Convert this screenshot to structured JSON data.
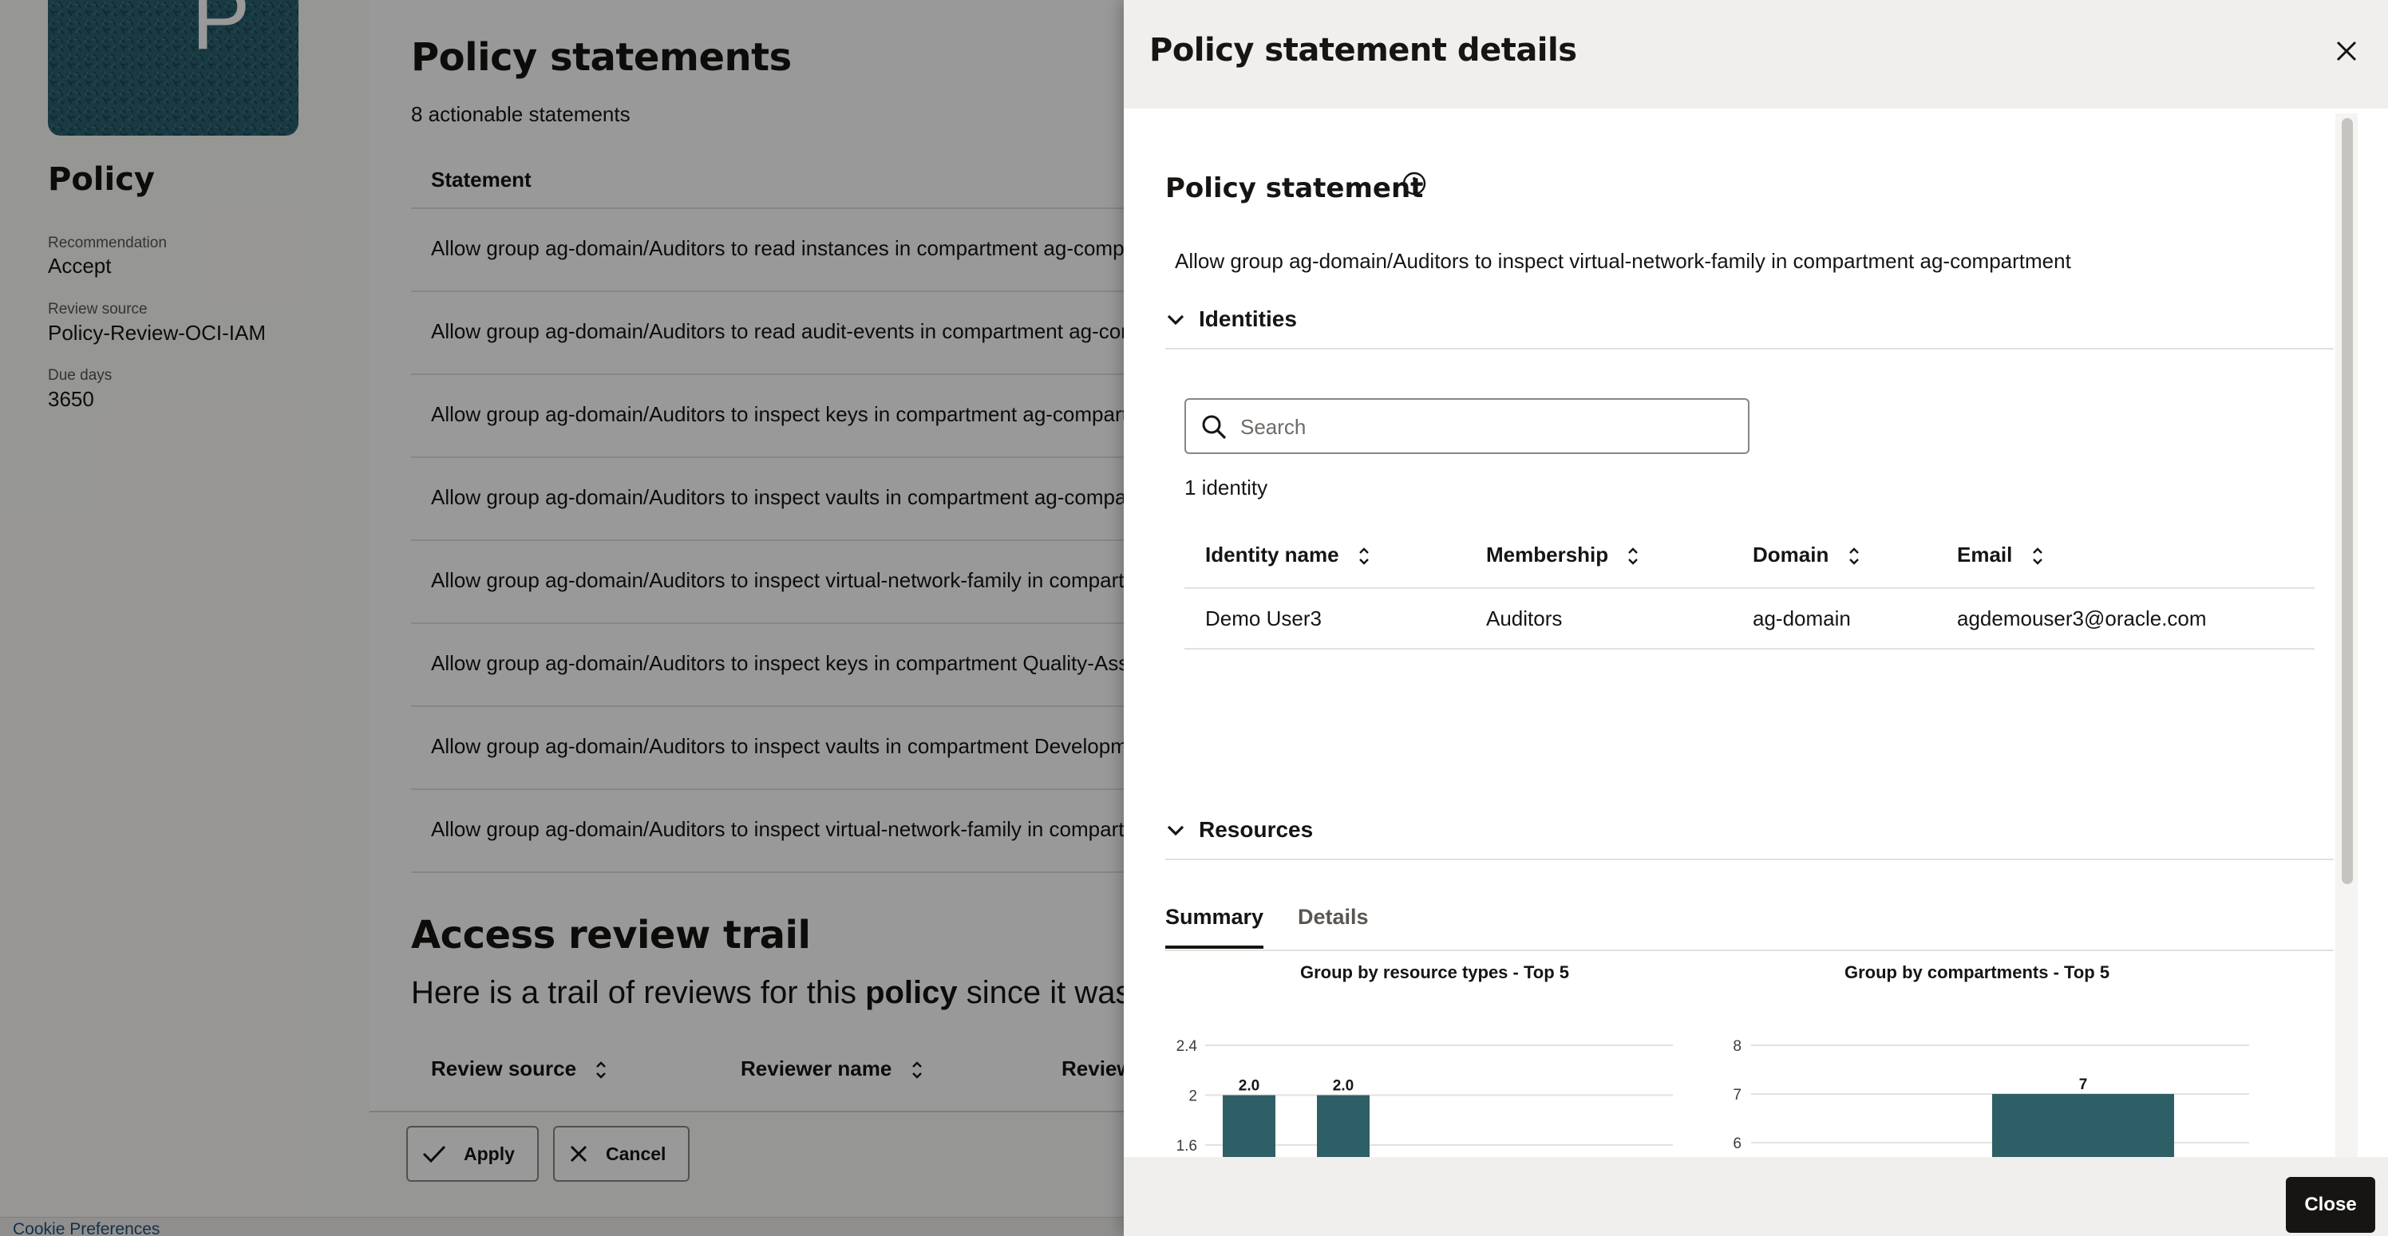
{
  "background": {
    "thumbnail_letter": "P",
    "policy_title": "Policy",
    "meta": [
      {
        "label": "Recommendation",
        "value": "Accept"
      },
      {
        "label": "Review source",
        "value": "Policy-Review-OCI-IAM"
      },
      {
        "label": "Due days",
        "value": "3650"
      }
    ],
    "statements_title": "Policy statements",
    "statements_count": "8 actionable statements",
    "statement_column": "Statement",
    "statements": [
      "Allow group ag-domain/Auditors to read instances in compartment ag-compartment",
      "Allow group ag-domain/Auditors to read audit-events in compartment ag-compartment",
      "Allow group ag-domain/Auditors to inspect keys in compartment ag-compartment",
      "Allow group ag-domain/Auditors to inspect vaults in compartment ag-compartment",
      "Allow group ag-domain/Auditors to inspect virtual-network-family in compartment ag-compartment",
      "Allow group ag-domain/Auditors to inspect keys in compartment Quality-Assurance",
      "Allow group ag-domain/Auditors to inspect vaults in compartment Development",
      "Allow group ag-domain/Auditors to inspect virtual-network-family in compartment Development"
    ],
    "trail_title": "Access review trail",
    "trail_sub_pre": "Here is a trail of reviews for this ",
    "trail_sub_bold": "policy",
    "trail_sub_post": " since it was created.",
    "trail_columns": [
      "Review source",
      "Reviewer name",
      "Review"
    ],
    "apply_label": "Apply",
    "cancel_label": "Cancel",
    "cookie_label": "Cookie Preferences"
  },
  "drawer": {
    "title": "Policy statement details",
    "section_title": "Policy statement",
    "statement": "Allow group ag-domain/Auditors to inspect virtual-network-family in compartment ag-compartment",
    "identities_label": "Identities",
    "search_placeholder": "Search",
    "identity_count": "1 identity",
    "identity_columns": [
      "Identity name",
      "Membership",
      "Domain",
      "Email"
    ],
    "identity_rows": [
      {
        "name": "Demo User3",
        "membership": "Auditors",
        "domain": "ag-domain",
        "email": "agdemouser3@oracle.com"
      }
    ],
    "resources_label": "Resources",
    "tabs": [
      {
        "label": "Summary",
        "active": true
      },
      {
        "label": "Details",
        "active": false
      }
    ],
    "close_label": "Close"
  },
  "colors": {
    "bar": "#2f5f66",
    "thumbnail": "#2b6271",
    "primary_button": "#161513"
  },
  "chart_data": [
    {
      "type": "bar",
      "title": "Group by resource types - Top 5",
      "yticks": [
        1.6,
        2.0,
        2.4
      ],
      "ylim": [
        1.6,
        2.4
      ],
      "values": [
        2.0,
        2.0
      ],
      "data_labels": [
        "2.0",
        "2.0"
      ],
      "grid": true
    },
    {
      "type": "bar",
      "title": "Group by compartments - Top 5",
      "yticks": [
        6,
        7,
        8
      ],
      "ylim": [
        6,
        8
      ],
      "values": [
        7
      ],
      "data_labels": [
        "7"
      ],
      "grid": true
    }
  ]
}
